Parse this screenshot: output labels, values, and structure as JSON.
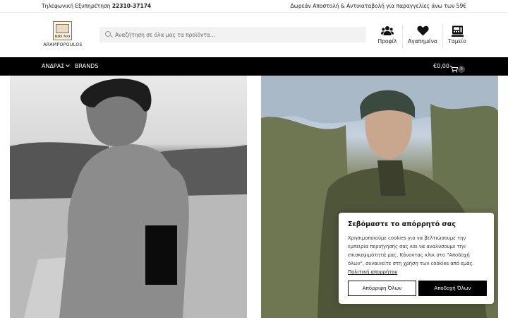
{
  "topbar": {
    "phone_label": "Τηλεφωνική Εξυπηρέτηση ",
    "phone_number": "22310-37174",
    "shipping": "Δωρεάν Αποστολή & Αντικαταβολή για παραγγελίες άνω των 59€"
  },
  "logo": {
    "crest_text": "BRUNO",
    "wordmark": "ARAMPOPOULOS"
  },
  "search": {
    "placeholder": "Αναζήτηση σε όλα μας τα προϊόντα..."
  },
  "header_icons": {
    "profile": "Προφίλ",
    "wishlist": "Αγαπημένα",
    "checkout": "Ταμείο"
  },
  "nav": {
    "men": "ΑΝΔΡΑΣ",
    "brands": "BRANDS",
    "cart_total": "€0,00",
    "cart_count": "0"
  },
  "cookie": {
    "title": "Σεβόμαστε το απόρρητό σας",
    "body": "Χρησιμοποιούμε cookies για να βελτιώσουμε την εμπειρία περιήγησής σας και να αναλύσουμε την επισκεψιμότητά μας. Κάνοντας κλικ στο \"Αποδοχή όλων\", συναινείτε στη χρήση των cookies από εμάς. ",
    "policy_link": "Πολιτική απορρήτου",
    "reject_label": "Απόρριψη Όλων",
    "accept_label": "Αποδοχή Όλων"
  }
}
